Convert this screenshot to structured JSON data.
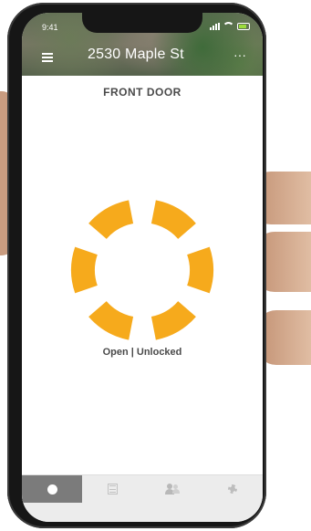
{
  "status_bar": {
    "time": "9:41"
  },
  "header": {
    "title": "2530 Maple St",
    "more_glyph": "···"
  },
  "lock": {
    "name": "FRONT DOOR",
    "status": "Open | Unlocked",
    "accent_color": "#f6aa1c"
  },
  "tabbar": {
    "tabs": [
      {
        "icon": "dot-icon",
        "active": true
      },
      {
        "icon": "list-icon",
        "active": false
      },
      {
        "icon": "users-icon",
        "active": false
      },
      {
        "icon": "gear-icon",
        "active": false
      }
    ]
  },
  "icons": {
    "menu": "menu-icon",
    "more": "more-icon",
    "signal": "signal-icon",
    "wifi": "wifi-icon",
    "battery": "battery-icon"
  }
}
